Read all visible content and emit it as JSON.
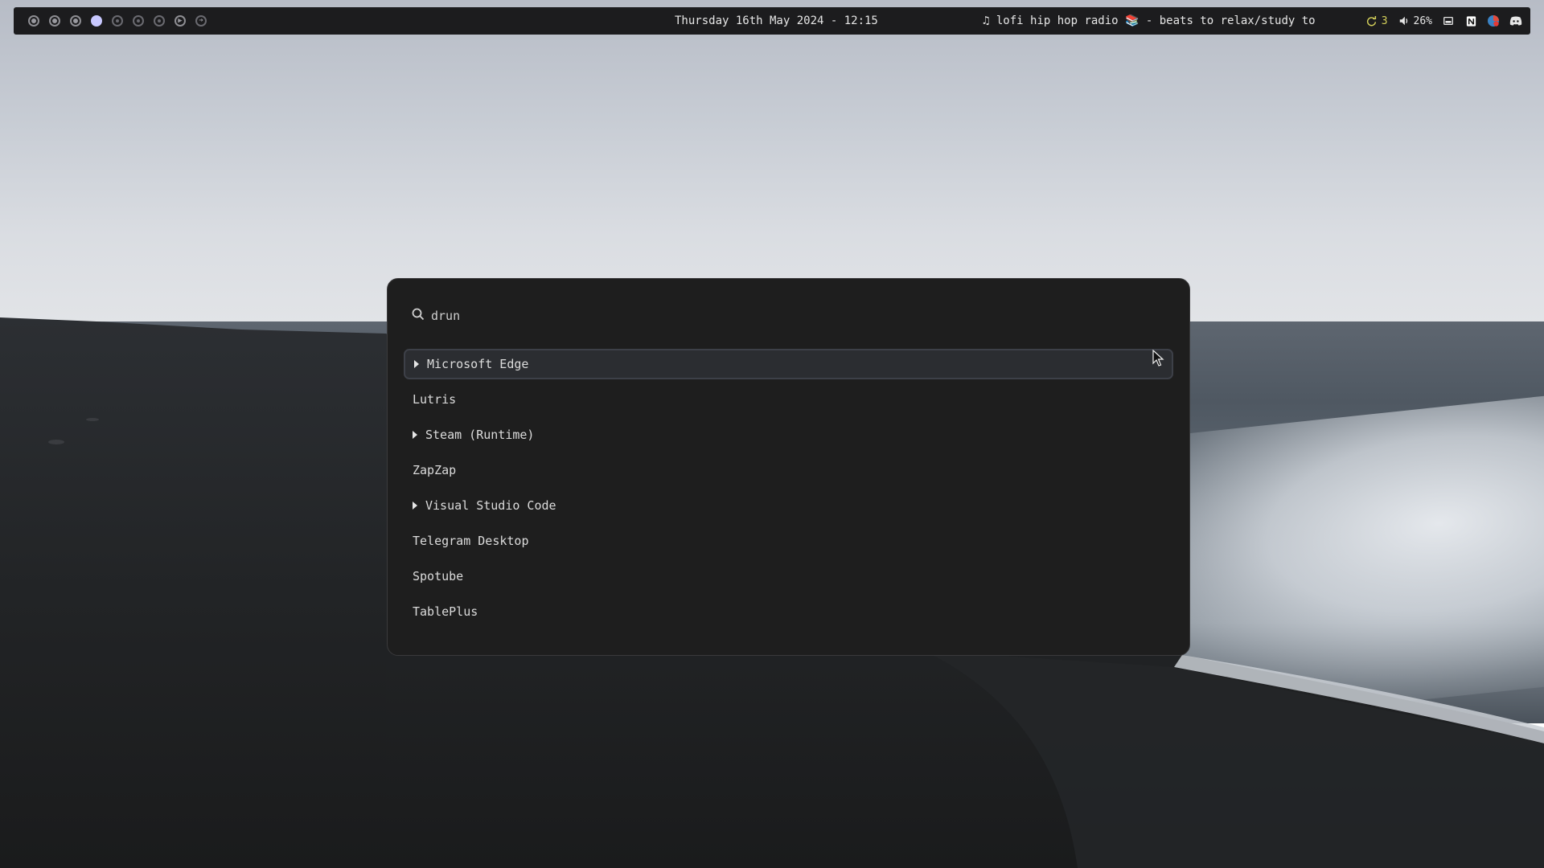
{
  "topbar": {
    "workspaces": [
      {
        "id": 1,
        "state": "occupied"
      },
      {
        "id": 2,
        "state": "occupied"
      },
      {
        "id": 3,
        "state": "occupied"
      },
      {
        "id": 4,
        "state": "active"
      },
      {
        "id": 5,
        "state": "empty"
      },
      {
        "id": 6,
        "state": "empty"
      },
      {
        "id": 7,
        "state": "empty"
      },
      {
        "id": 8,
        "state": "special"
      },
      {
        "id": 9,
        "state": "special-outline"
      }
    ],
    "clock": "Thursday 16th May 2024 - 12:15",
    "media": {
      "icon": "music-note-icon",
      "title": "lofi hip hop radio 📚 - beats to relax/study to"
    },
    "tray": {
      "updates_count": "3",
      "volume": "26%",
      "icons": [
        "refresh-icon",
        "volume-icon",
        "screenshot-icon",
        "notion-icon",
        "browser-icon",
        "discord-icon"
      ]
    }
  },
  "launcher": {
    "mode": "drun",
    "results": [
      {
        "label": "Microsoft Edge",
        "has_submenu": true,
        "selected": true
      },
      {
        "label": "Lutris",
        "has_submenu": false,
        "selected": false
      },
      {
        "label": "Steam (Runtime)",
        "has_submenu": true,
        "selected": false
      },
      {
        "label": "ZapZap",
        "has_submenu": false,
        "selected": false
      },
      {
        "label": "Visual Studio Code",
        "has_submenu": true,
        "selected": false
      },
      {
        "label": "Telegram Desktop",
        "has_submenu": false,
        "selected": false
      },
      {
        "label": "Spotube",
        "has_submenu": false,
        "selected": false
      },
      {
        "label": "TablePlus",
        "has_submenu": false,
        "selected": false
      }
    ]
  },
  "colors": {
    "bar_bg": "#1c1c1e",
    "launcher_bg": "#1e1e1e",
    "selected_bg": "#2b2d31",
    "active_workspace": "#c8c8ff",
    "updates_accent": "#d4d05a"
  }
}
